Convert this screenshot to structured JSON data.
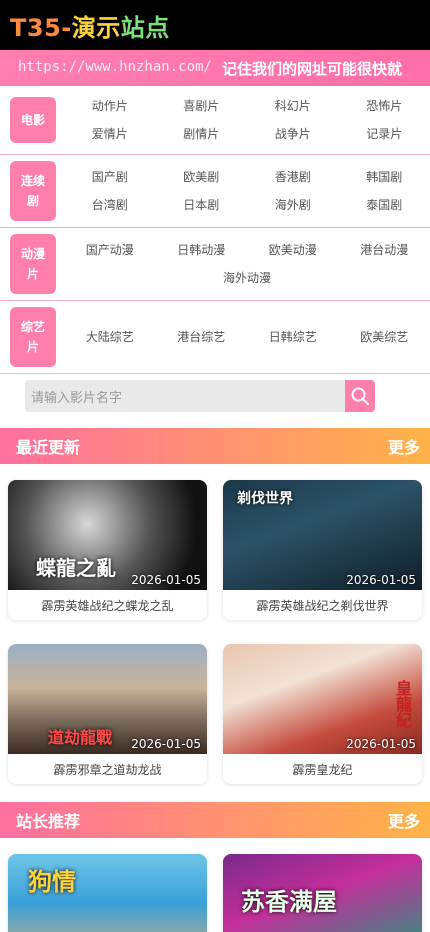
{
  "header": {
    "logo_part1": "T35-",
    "logo_part2": "演示",
    "logo_part3": "站点"
  },
  "notice": {
    "url": "https://www.hnzhan.com/",
    "text": "记住我们的网址可能很快就"
  },
  "categories": [
    {
      "label": "电影",
      "items": [
        "动作片",
        "喜剧片",
        "科幻片",
        "恐怖片",
        "爱情片",
        "剧情片",
        "战争片",
        "记录片"
      ]
    },
    {
      "label": "连续剧",
      "items": [
        "国产剧",
        "欧美剧",
        "香港剧",
        "韩国剧",
        "台湾剧",
        "日本剧",
        "海外剧",
        "泰国剧"
      ]
    },
    {
      "label": "动漫片",
      "items": [
        "国产动漫",
        "日韩动漫",
        "欧美动漫",
        "港台动漫",
        "海外动漫"
      ]
    },
    {
      "label": "综艺片",
      "items": [
        "大陆综艺",
        "港台综艺",
        "日韩综艺",
        "欧美综艺"
      ]
    }
  ],
  "search": {
    "placeholder": "请输入影片名字"
  },
  "recent": {
    "title": "最近更新",
    "more": "更多",
    "items": [
      {
        "title": "霹雳英雄战纪之蝶龙之乱",
        "date": "2026-01-05",
        "poster_text": "蝶龍之亂"
      },
      {
        "title": "霹雳英雄战纪之剃伐世界",
        "date": "2026-01-05",
        "poster_text": "剃伐世界"
      },
      {
        "title": "霹雳邪章之道劫龙战",
        "date": "2026-01-05",
        "poster_text": "道劫龍戰"
      },
      {
        "title": "霹雳皇龙纪",
        "date": "2026-01-05",
        "poster_text": "皇龍紀"
      }
    ]
  },
  "recommend": {
    "title": "站长推荐",
    "more": "更多",
    "items": [
      {
        "poster_text": "狗情"
      },
      {
        "poster_text": "苏香满屋"
      }
    ]
  },
  "colors": {
    "accent": "#ff7eac",
    "header_bg": "#000000",
    "section_gradient_start": "#ff6f9f",
    "section_gradient_end": "#ffb347"
  }
}
